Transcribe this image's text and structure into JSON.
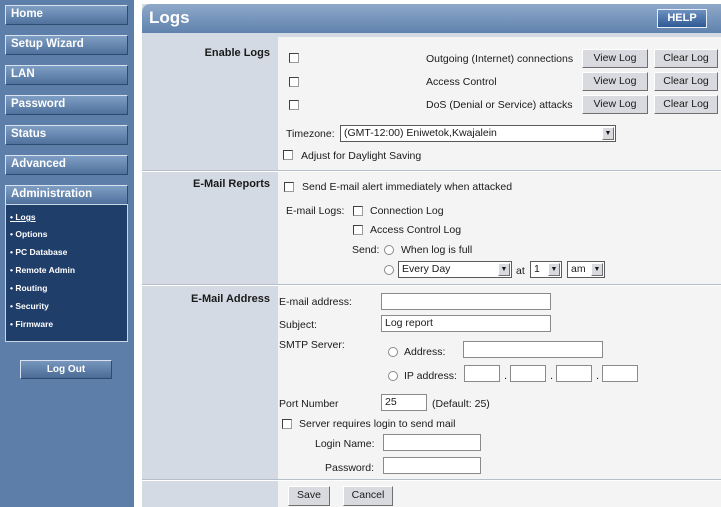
{
  "sidebar": {
    "nav": [
      "Home",
      "Setup Wizard",
      "LAN",
      "Password",
      "Status",
      "Advanced",
      "Administration"
    ],
    "submenu": [
      "Logs",
      "Options",
      "PC Database",
      "Remote Admin",
      "Routing",
      "Security",
      "Firmware"
    ],
    "logout": "Log Out"
  },
  "header": {
    "title": "Logs",
    "help": "HELP"
  },
  "enable_logs": {
    "label": "Enable Logs",
    "rows": [
      {
        "text": "Outgoing (Internet) connections",
        "checked": false,
        "view": "View Log",
        "clear": "Clear Log"
      },
      {
        "text": "Access Control",
        "checked": false,
        "view": "View Log",
        "clear": "Clear Log"
      },
      {
        "text": "DoS (Denial or Service) attacks",
        "checked": false,
        "view": "View Log",
        "clear": "Clear Log"
      }
    ],
    "timezone_label": "Timezone:",
    "timezone_value": "(GMT-12:00) Eniwetok,Kwajalein",
    "dst_label": "Adjust for Daylight Saving",
    "dst_checked": false
  },
  "email_reports": {
    "label": "E-Mail Reports",
    "send_alert": "Send E-mail alert immediately when attacked",
    "email_logs_label": "E-mail Logs:",
    "connection_log": "Connection Log",
    "access_control_log": "Access Control Log",
    "send_label": "Send:",
    "when_full": "When log is full",
    "schedule_value": "Every Day",
    "at_label": "at",
    "hour_value": "1",
    "ampm_value": "am"
  },
  "email_address": {
    "label": "E-Mail Address",
    "address_label": "E-mail address:",
    "address_value": "",
    "subject_label": "Subject:",
    "subject_value": "Log report",
    "smtp_label": "SMTP Server:",
    "address_opt": "Address:",
    "ip_opt": "IP address:",
    "port_label": "Port Number",
    "port_value": "25",
    "port_default": "(Default: 25)",
    "login_req": "Server requires login to send mail",
    "login_name_label": "Login Name:",
    "password_label": "Password:"
  },
  "actions": {
    "save": "Save",
    "cancel": "Cancel"
  }
}
